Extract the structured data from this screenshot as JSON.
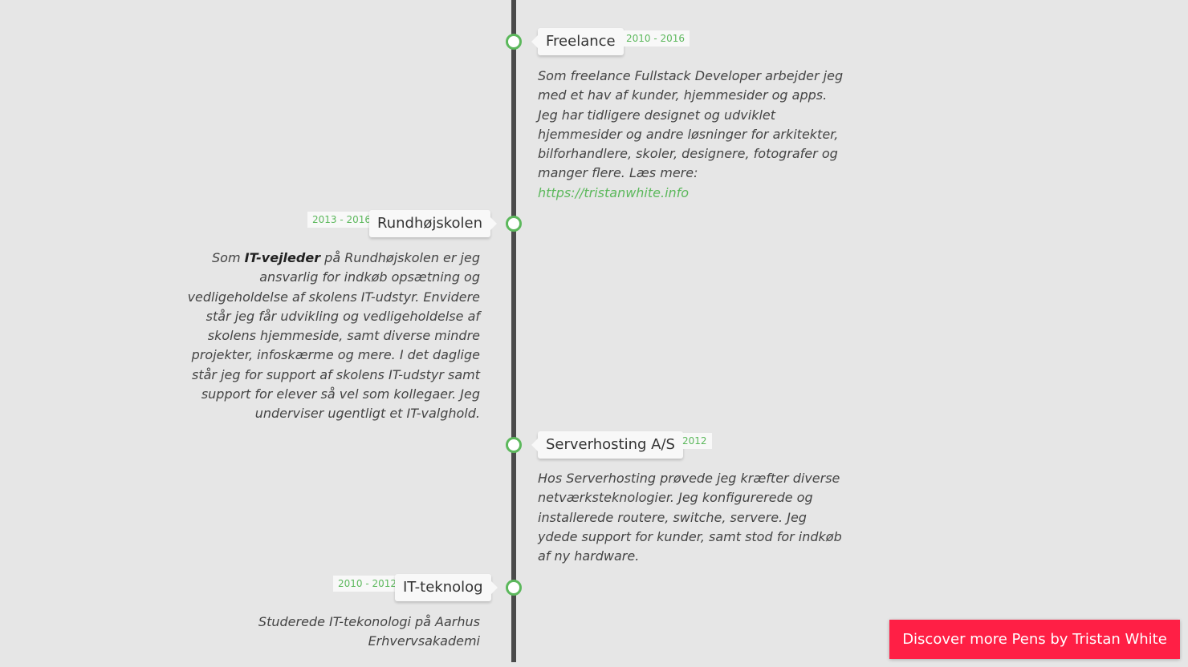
{
  "timeline": {
    "freelance": {
      "title": "Freelance",
      "period": "2010 - 2016",
      "description": "Som freelance Fullstack Developer arbejder jeg med et hav af kunder, hjemmesider og apps. Jeg har tidligere designet og udviklet hjemmesider og andre løsninger for arkitekter, bilforhandlere, skoler, designere, fotografer og manger flere. Læs mere:",
      "link_text": "https://tristanwhite.info"
    },
    "rundhojskolen": {
      "title": "Rundhøjskolen",
      "period": "2013 - 2016",
      "desc_before": "Som ",
      "desc_bold": "IT-vejleder",
      "desc_after": " på Rundhøjskolen er jeg ansvarlig for indkøb opsætning og vedligeholdelse af skolens IT-udstyr. Envidere står jeg får udvikling og vedligeholdelse af skolens hjemmeside, samt diverse mindre projekter, infoskærme og mere. I det daglige står jeg for support af skolens IT-udstyr samt support for elever så vel som kollegaer. Jeg underviser ugentligt et IT-valghold."
    },
    "serverhosting": {
      "title": "Serverhosting A/S",
      "period": "2012",
      "description": "Hos Serverhosting prøvede jeg kræfter diverse netværksteknologier. Jeg konfigurerede og installerede routere, switche, servere. Jeg ydede support for kunder, samt stod for indkøb af ny hardware."
    },
    "itteknolog": {
      "title": "IT-teknolog",
      "period": "2010 - 2012",
      "description": "Studerede IT-tekonologi på Aarhus Erhvervsakademi"
    }
  },
  "discover_button": "Discover more Pens by Tristan White",
  "colors": {
    "background": "#e6e6e6",
    "line": "#4a4a4a",
    "accent": "#5cb85c",
    "discover": "#ff1f45"
  }
}
